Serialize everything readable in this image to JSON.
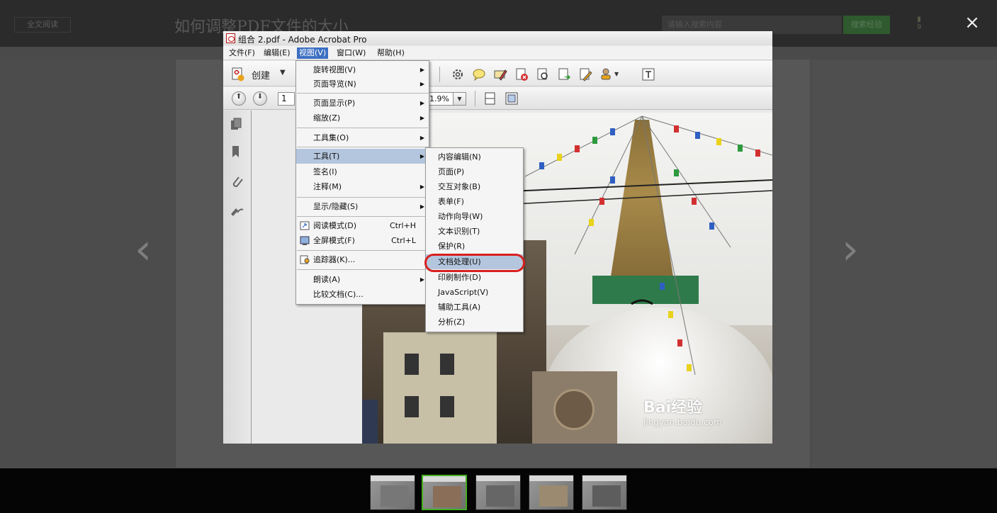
{
  "background_page": {
    "fulltext_button": "全文阅读",
    "title": "如何调整PDF文件的大小",
    "search_placeholder": "请输入搜索内容",
    "search_button": "搜索经验",
    "like_count": "9",
    "close_symbol": "×"
  },
  "acrobat": {
    "window_title": "组合 2.pdf - Adobe Acrobat Pro",
    "menubar": [
      {
        "label": "文件(F)"
      },
      {
        "label": "编辑(E)"
      },
      {
        "label": "视图(V)"
      },
      {
        "label": "窗口(W)"
      },
      {
        "label": "帮助(H)"
      }
    ],
    "toolbar": {
      "create_label": "创建",
      "page_number": "1",
      "zoom_value": "1.9%"
    }
  },
  "view_menu": {
    "items": [
      {
        "label": "旋转视图(V)"
      },
      {
        "label": "页面导览(N)"
      },
      {
        "label": "页面显示(P)"
      },
      {
        "label": "缩放(Z)"
      },
      {
        "label": "工具集(O)"
      },
      {
        "label": "工具(T)"
      },
      {
        "label": "签名(I)"
      },
      {
        "label": "注释(M)"
      },
      {
        "label": "显示/隐藏(S)"
      },
      {
        "label": "阅读模式(D)",
        "shortcut": "Ctrl+H"
      },
      {
        "label": "全屏模式(F)",
        "shortcut": "Ctrl+L"
      },
      {
        "label": "追踪器(K)..."
      },
      {
        "label": "朗读(A)"
      },
      {
        "label": "比较文档(C)..."
      }
    ]
  },
  "tools_submenu": {
    "items": [
      {
        "label": "内容编辑(N)"
      },
      {
        "label": "页面(P)"
      },
      {
        "label": "交互对象(B)"
      },
      {
        "label": "表单(F)"
      },
      {
        "label": "动作向导(W)"
      },
      {
        "label": "文本识别(T)"
      },
      {
        "label": "保护(R)"
      },
      {
        "label": "文档处理(U)"
      },
      {
        "label": "印刷制作(D)"
      },
      {
        "label": "JavaScript(V)"
      },
      {
        "label": "辅助工具(A)"
      },
      {
        "label": "分析(Z)"
      }
    ]
  },
  "watermark": {
    "brand": "Bai经验",
    "url": "jingyan.baidu.com"
  },
  "colors": {
    "highlight": "#b4c6de",
    "menu_active": "#3c6fc3",
    "annotation": "#d82020",
    "thumb_active_border": "#45b020"
  }
}
